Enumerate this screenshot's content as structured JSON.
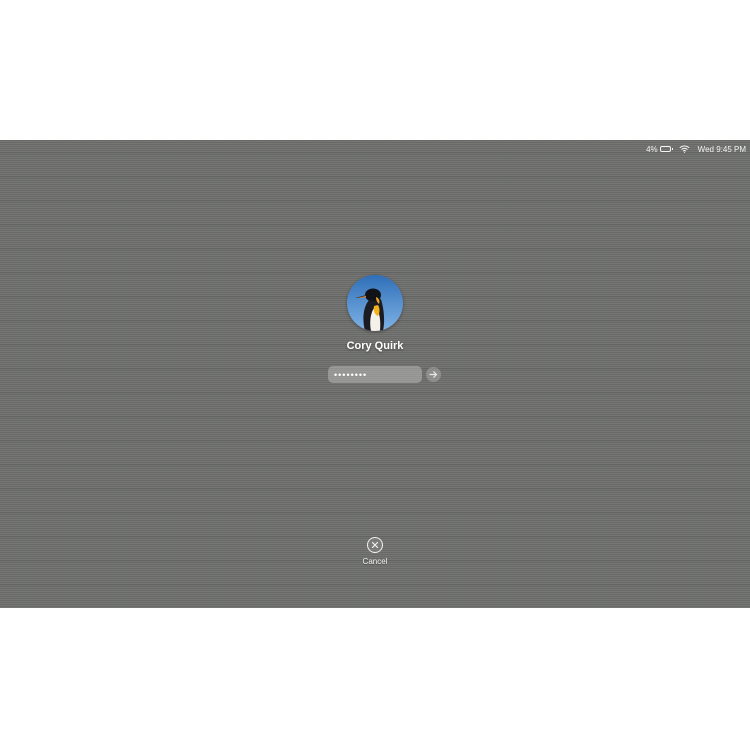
{
  "menubar": {
    "battery_text": "4%",
    "battery_icon": "battery-low-icon",
    "wifi_icon": "wifi-icon",
    "clock": "Wed 9:45 PM"
  },
  "login": {
    "avatar_icon": "penguin-avatar",
    "user_name": "Cory Quirk",
    "password_value": "••••••••",
    "submit_icon": "arrow-right-icon",
    "cancel_icon": "close-icon",
    "cancel_label": "Cancel"
  },
  "colors": {
    "text": "#ffffff",
    "field_background": "#9a9a9a"
  }
}
